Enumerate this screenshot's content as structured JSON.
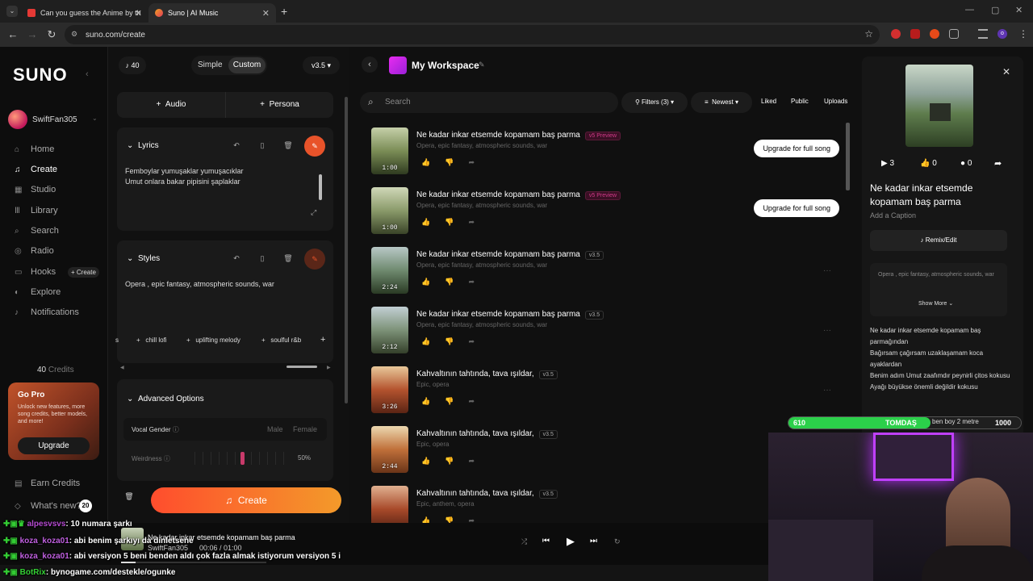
{
  "browser": {
    "tabs": [
      {
        "title": "Can you guess the Anime by th",
        "active": false
      },
      {
        "title": "Suno | AI Music",
        "active": true
      }
    ],
    "url": "suno.com/create"
  },
  "sidebar": {
    "logo": "SUNO",
    "username": "SwiftFan305",
    "nav": [
      {
        "label": "Home",
        "icon": "home-icon"
      },
      {
        "label": "Create",
        "icon": "music-icon"
      },
      {
        "label": "Studio",
        "icon": "grid-icon"
      },
      {
        "label": "Library",
        "icon": "library-icon"
      },
      {
        "label": "Search",
        "icon": "search-icon"
      },
      {
        "label": "Radio",
        "icon": "radio-icon"
      },
      {
        "label": "Hooks",
        "icon": "hook-icon"
      },
      {
        "label": "Explore",
        "icon": "compass-icon"
      },
      {
        "label": "Notifications",
        "icon": "bell-icon"
      }
    ],
    "hooks_create": "+ Create",
    "credits": "40",
    "credits_label": "Credits",
    "gopro": {
      "title": "Go Pro",
      "text": "Unlock new features, more song credits, better models, and more!",
      "button": "Upgrade"
    },
    "earn_credits": "Earn Credits",
    "whats_new": "What's new?",
    "whats_new_count": "20"
  },
  "panel": {
    "credit_count": "40",
    "modes": [
      "Simple",
      "Custom"
    ],
    "version": "v3.5",
    "audio_button": "Audio",
    "persona_button": "Persona",
    "lyrics_header": "Lyrics",
    "lyrics_text": "Femboylar yumuşaklar yumuşacıklar\nUmut onlara bakar pipisini şaplaklar",
    "styles_header": "Styles",
    "styles_text": "Opera , epic fantasy, atmospheric sounds, war",
    "style_chips": [
      "s",
      "chill lofi",
      "uplifting melody",
      "soulful r&b",
      "+"
    ],
    "advanced_options": "Advanced Options",
    "vocal_gender_label": "Vocal Gender",
    "vocal_options": [
      "Male",
      "Female"
    ],
    "weirdness_label": "Weirdness",
    "weirdness_value": "50%",
    "create_button": "Create"
  },
  "workspace": {
    "title": "My Workspace",
    "search_placeholder": "Search",
    "filters": "Filters (3)",
    "sort": "Newest",
    "liked": "Liked",
    "public": "Public",
    "uploads": "Uploads",
    "songs": [
      {
        "title": "Ne kadar inkar etsemde kopamam baş parma",
        "tag": "v5 Preview",
        "style": "Opera, epic fantasy, atmospheric sounds, war",
        "duration": "1:00",
        "action": "Upgrade for full song"
      },
      {
        "title": "Ne kadar inkar etsemde kopamam baş parma",
        "tag": "v5 Preview",
        "style": "Opera, epic fantasy, atmospheric sounds, war",
        "duration": "1:00",
        "action": "Upgrade for full song"
      },
      {
        "title": "Ne kadar inkar etsemde kopamam baş parma",
        "tag": "v3.5",
        "style": "Opera, epic fantasy, atmospheric sounds, war",
        "duration": "2:24",
        "action": ""
      },
      {
        "title": "Ne kadar inkar etsemde kopamam baş parma",
        "tag": "v3.5",
        "style": "Opera, epic fantasy, atmospheric sounds, war",
        "duration": "2:12",
        "action": ""
      },
      {
        "title": "Kahvaltının tahtında, tava ışıldar,",
        "tag": "v3.5",
        "style": "Epic, opera",
        "duration": "3:26",
        "action": ""
      },
      {
        "title": "Kahvaltının tahtında, tava ışıldar,",
        "tag": "v3.5",
        "style": "Epic, opera",
        "duration": "2:44",
        "action": ""
      },
      {
        "title": "Kahvaltının tahtında, tava ışıldar,",
        "tag": "v3.5",
        "style": "Epic, anthem, opera",
        "duration": "",
        "action": ""
      }
    ]
  },
  "detail": {
    "plays": "3",
    "likes": "0",
    "comments": "0",
    "title": "Ne kadar inkar etsemde kopamam baş parma",
    "caption_placeholder": "Add a Caption",
    "remix": "Remix/Edit",
    "style": "Opera , epic fantasy, atmospheric sounds, war",
    "show_more": "Show More",
    "lyrics": "Ne kadar inkar etsemde kopamam baş parmağından\nBağırsam çağırsam uzaklaşamam koca ayaklardan\nBenim adım Umut zaafımdır peynirli çitos kokusu\nAyağı büyükse önemli değildir kokusu",
    "lyrics_more": "ben boy 2 metre"
  },
  "player": {
    "title": "Ne kadar inkar etsemde kopamam baş parma",
    "artist": "SwiftFan305",
    "time": "00:06 / 01:00",
    "progress": 0.1
  },
  "stream": {
    "bar_left": "610",
    "bar_name": "TOMDAŞ",
    "bar_right": "1000",
    "chat": [
      {
        "user": "alpesvsvs",
        "msg": ": 10 numara şarkı",
        "color": "#b44ad0"
      },
      {
        "user": "koza_koza01",
        "msg": ": abi benim şarkıyı da dinletsene",
        "color": "#c060e0"
      },
      {
        "user": "koza_koza01",
        "msg": ": abi versiyon 5 beni benden aldı çok fazla almak istiyorum versiyon 5 i",
        "color": "#c060e0"
      },
      {
        "user": "BotRix",
        "msg": ": bynogame.com/destekle/ogunke",
        "color": "#35d035"
      }
    ]
  },
  "colors": {
    "accent": "#ff5a1f",
    "create_gradient_start": "#ff4d2d",
    "create_gradient_end": "#f39a2a",
    "stream_green": "#2bd04a"
  }
}
